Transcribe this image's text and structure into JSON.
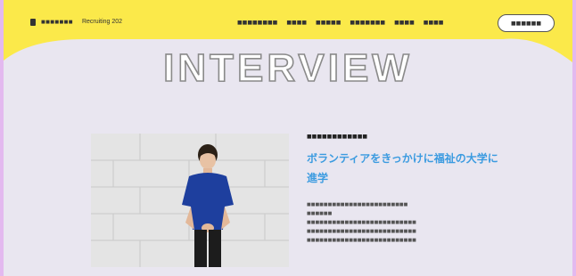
{
  "header": {
    "logo_text": "■■■■■■■",
    "logo_sub": "Recruiting 202",
    "nav": [
      "■■■■■■■■",
      "■■■■",
      "■■■■■",
      "■■■■■■■",
      "■■■■",
      "■■■■"
    ],
    "entry_label": "■■■■■■"
  },
  "main": {
    "heading": "INTERVIEW",
    "person_meta": "■■■■■■■■■■■■",
    "headline": "ボランティアをきっかけに福祉の大学に進学",
    "body_lines": [
      "■■■■■■■■■■■■■■■■■■■■■■■■",
      "■■■■■■",
      "■■■■■■■■■■■■■■■■■■■■■■■■■■",
      "■■■■■■■■■■■■■■■■■■■■■■■■■■",
      "■■■■■■■■■■■■■■■■■■■■■■■■■■"
    ]
  },
  "colors": {
    "header_yellow": "#fbe94a",
    "background": "#e9e6f0",
    "headline_blue": "#3b9be0",
    "shirt_blue": "#1e3f9e"
  },
  "icons": {
    "logo": "logo-mark-icon"
  }
}
